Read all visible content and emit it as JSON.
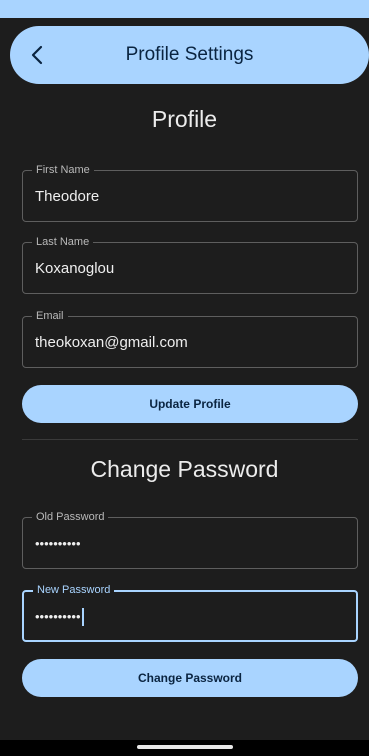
{
  "colors": {
    "accent": "#a9d4ff",
    "background": "#1d1d1d",
    "outline": "#5e5e5e",
    "on_accent": "#0a2440"
  },
  "app_bar": {
    "back_icon": "chevron-left-icon",
    "title": "Profile Settings"
  },
  "profile": {
    "heading": "Profile",
    "first_name": {
      "label": "First Name",
      "value": "Theodore"
    },
    "last_name": {
      "label": "Last Name",
      "value": "Koxanoglou"
    },
    "email": {
      "label": "Email",
      "value": "theokoxan@gmail.com"
    },
    "update_button": "Update Profile"
  },
  "password": {
    "heading": "Change Password",
    "old_password": {
      "label": "Old Password",
      "value": "••••••••••"
    },
    "new_password": {
      "label": "New Password",
      "value": "••••••••••"
    },
    "change_button": "Change Password"
  }
}
